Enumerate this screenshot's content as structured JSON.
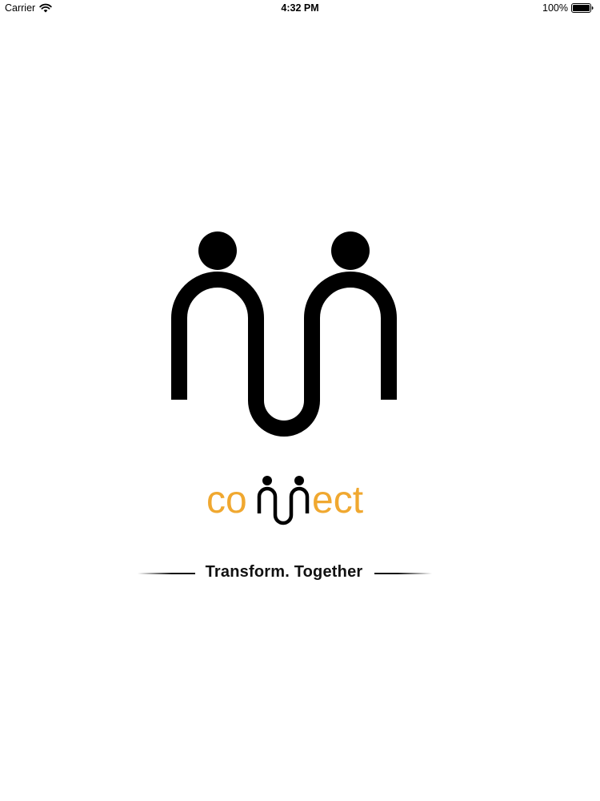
{
  "status_bar": {
    "carrier": "Carrier",
    "time": "4:32 PM",
    "battery": "100%",
    "wifi_icon": "wifi-icon",
    "battery_icon": "battery-icon"
  },
  "brand": {
    "logo_icon": "two-people-connected-logo",
    "wordmark": {
      "prefix": "co",
      "suffix": "ect"
    },
    "tagline": "Transform. Together",
    "colors": {
      "accent": "#F0A830",
      "ink": "#000000",
      "background": "#FFFFFF"
    }
  }
}
